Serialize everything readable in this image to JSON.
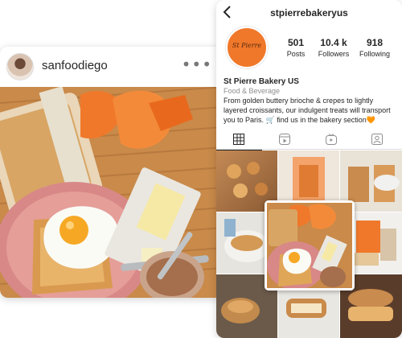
{
  "post": {
    "username": "sanfoodiego",
    "more_icon": "more-horizontal-icon"
  },
  "profile": {
    "handle": "stpierrebakeryus",
    "avatar_text": "St Pierre",
    "stats": [
      {
        "value": "501",
        "label": "Posts"
      },
      {
        "value": "10.4 k",
        "label": "Followers"
      },
      {
        "value": "918",
        "label": "Following"
      }
    ],
    "name": "St Pierre Bakery US",
    "category": "Food & Beverage",
    "bio": "From golden buttery brioche & crepes to lightly layered croissants, our indulgent treats will transport you to Paris. 🛒 find us in the bakery section🧡",
    "tabs": [
      "grid-icon",
      "reels-icon",
      "igtv-icon",
      "tagged-icon"
    ],
    "colors": {
      "brand": "#f0782a",
      "text": "#262626",
      "muted": "#8e8e8e"
    }
  }
}
